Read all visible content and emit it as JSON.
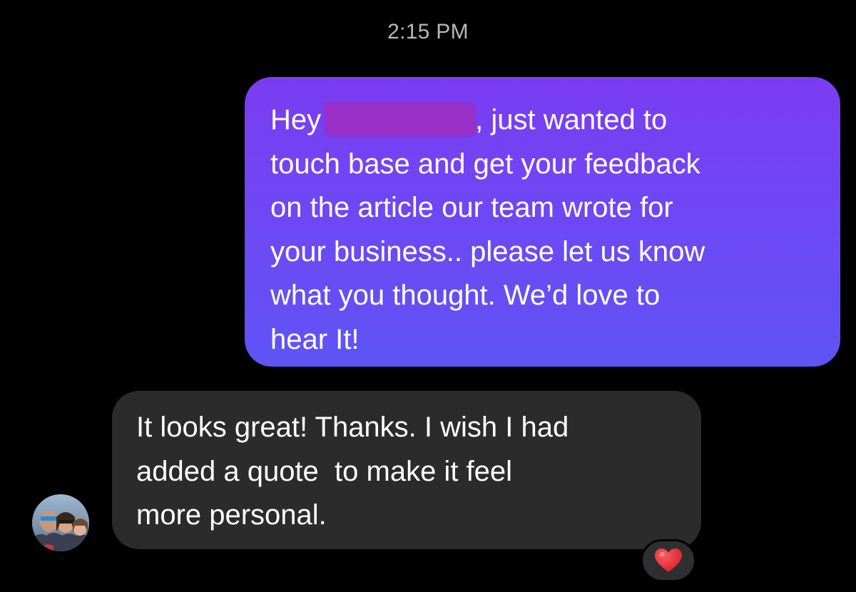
{
  "thread": {
    "timestamp": "2:15 PM"
  },
  "messages": [
    {
      "direction": "outgoing",
      "lines": [
        "Hey",
        ", just wanted to",
        "touch base and get your feedback",
        "on the article our team wrote for",
        "your business.. please let us know",
        "what you thought. We’d love to",
        "hear It!"
      ],
      "redacted": true
    },
    {
      "direction": "incoming",
      "lines": [
        "It looks great! Thanks. I wish I had",
        "added a quote  to make it feel",
        "more personal."
      ],
      "reaction": "heart-icon"
    }
  ],
  "colors": {
    "outgoing_top": "#7b3cf2",
    "outgoing_bottom": "#5f54f5",
    "incoming_bubble": "#2b2b2b",
    "timestamp": "#b8b8bd",
    "redaction": "#9a2fc8",
    "heart": "#e0242b"
  },
  "icons": {
    "avatar": "avatar-icon",
    "reaction": "heart-icon"
  }
}
